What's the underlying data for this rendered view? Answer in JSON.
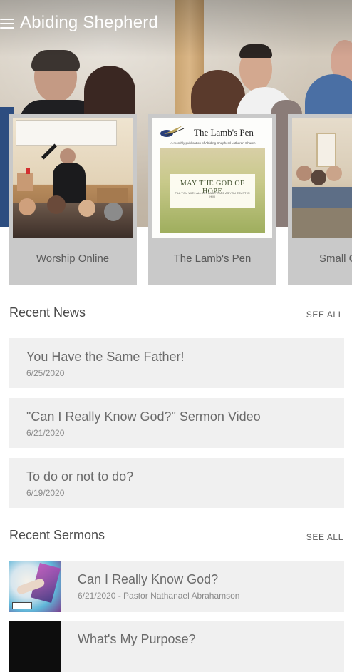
{
  "app": {
    "title": "Abiding Shepherd"
  },
  "features": [
    {
      "label": "Worship Online"
    },
    {
      "label": "The Lamb's Pen"
    },
    {
      "label": "Small Groups"
    }
  ],
  "lambs_pen_thumb": {
    "title": "The Lamb's Pen",
    "subtitle": "A monthly publication of Abiding Shepherd Lutheran Church",
    "heading": "MAY THE GOD OF HOPE",
    "verse": "FILL YOU WITH ALL JOY AND PEACE AS YOU TRUST IN HIM"
  },
  "news": {
    "title": "Recent News",
    "see_all": "SEE ALL",
    "items": [
      {
        "title": "You Have the Same Father!",
        "date": "6/25/2020"
      },
      {
        "title": "\"Can I Really Know God?\" Sermon Video",
        "date": "6/21/2020"
      },
      {
        "title": "To do or not to do?",
        "date": "6/19/2020"
      }
    ]
  },
  "sermons": {
    "title": "Recent Sermons",
    "see_all": "SEE ALL",
    "items": [
      {
        "title": "Can I Really Know God?",
        "meta": "6/21/2020 - Pastor Nathanael Abrahamson"
      },
      {
        "title": "What's My Purpose?",
        "meta": ""
      }
    ]
  }
}
